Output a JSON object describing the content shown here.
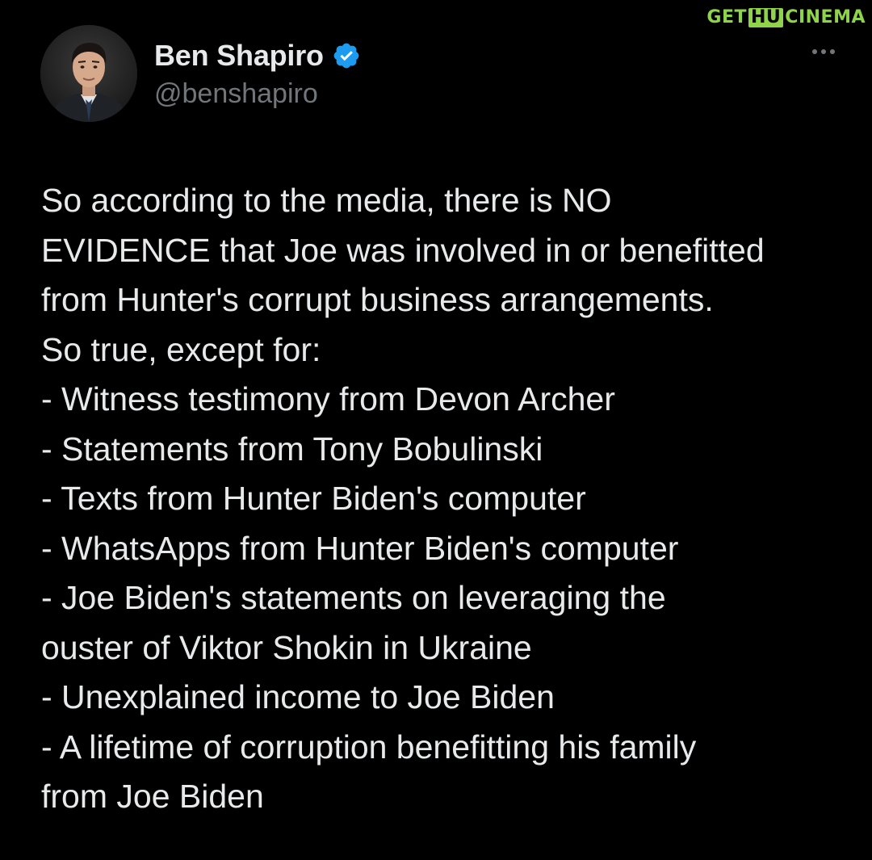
{
  "watermark": {
    "part1": "GET",
    "part2": "HU",
    "part3": "CINEMA"
  },
  "author": {
    "display_name": "Ben Shapiro",
    "handle": "@benshapiro",
    "verified": true,
    "verified_color": "#1d9bf0"
  },
  "menu": {
    "icon": "more-horizontal-icon"
  },
  "tweet": {
    "lines": [
      "So according to the media, there is NO",
      "EVIDENCE that Joe was involved in or benefitted",
      "from Hunter's corrupt business arrangements.",
      "So true, except for:",
      "- Witness testimony from Devon Archer",
      "- Statements from Tony Bobulinski",
      "- Texts from Hunter Biden's computer",
      "- WhatsApps from Hunter Biden's computer",
      "- Joe Biden's statements on leveraging the",
      "ouster of Viktor Shokin in Ukraine",
      "- Unexplained income to Joe Biden",
      "- A lifetime of corruption benefitting his family",
      "from Joe Biden"
    ]
  },
  "colors": {
    "background": "#000000",
    "text_primary": "#e7e9ea",
    "text_secondary": "#71767b",
    "watermark": "#8fd34a"
  }
}
